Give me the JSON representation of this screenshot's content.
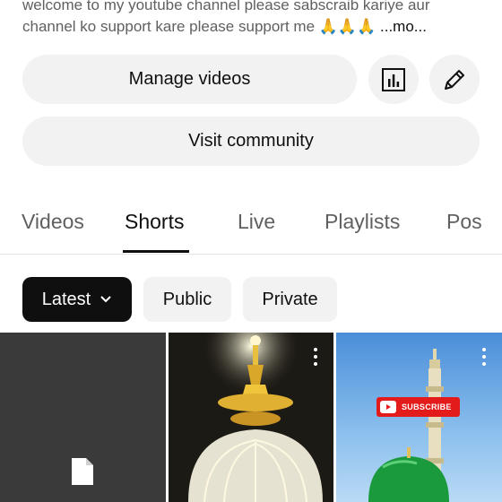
{
  "description": {
    "line1": "welcome to my  youtube channel please sabscraib kariye aur",
    "line2": "channel ko support kare please support me 🙏🙏🙏",
    "more": "...mo..."
  },
  "buttons": {
    "manage_videos": "Manage videos",
    "visit_community": "Visit community"
  },
  "tabs": [
    {
      "label": "Videos"
    },
    {
      "label": "Shorts"
    },
    {
      "label": "Live"
    },
    {
      "label": "Playlists"
    },
    {
      "label": "Pos"
    }
  ],
  "filters": {
    "latest": "Latest",
    "public": "Public",
    "private": "Private"
  },
  "thumbnails": {
    "subscribe_label": "SUBSCRIBE"
  },
  "colors": {
    "accent_dark": "#0f0f0f",
    "chip_bg": "#f2f2f2",
    "subscribe_red": "#e31b1b"
  }
}
